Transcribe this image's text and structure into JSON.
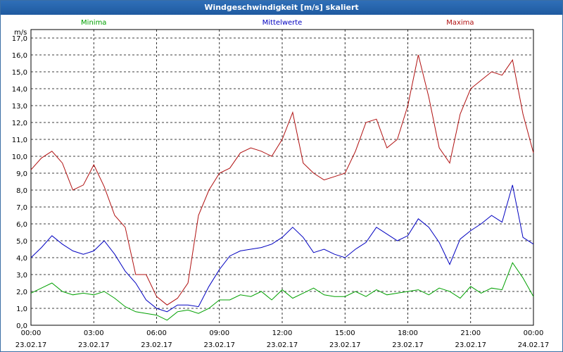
{
  "window": {
    "title": "Windgeschwindigkeit [m/s] skaliert"
  },
  "chart_data": {
    "type": "line",
    "title": "Windgeschwindigkeit [m/s] skaliert",
    "ylabel": "m/s",
    "ylim": [
      0,
      17.5
    ],
    "xlim": [
      0,
      24
    ],
    "grid": true,
    "legend_placement": "top",
    "y_ticks": [
      "0,0",
      "1,0",
      "2,0",
      "3,0",
      "4,0",
      "5,0",
      "6,0",
      "7,0",
      "8,0",
      "9,0",
      "10,0",
      "11,0",
      "12,0",
      "13,0",
      "14,0",
      "15,0",
      "16,0",
      "17,0"
    ],
    "x_ticks": [
      {
        "time": "00:00",
        "date": "23.02.17"
      },
      {
        "time": "03:00",
        "date": "23.02.17"
      },
      {
        "time": "06:00",
        "date": "23.02.17"
      },
      {
        "time": "09:00",
        "date": "23.02.17"
      },
      {
        "time": "12:00",
        "date": "23.02.17"
      },
      {
        "time": "15:00",
        "date": "23.02.17"
      },
      {
        "time": "18:00",
        "date": "23.02.17"
      },
      {
        "time": "21:00",
        "date": "23.02.17"
      },
      {
        "time": "00:00",
        "date": "24.02.17"
      }
    ],
    "series": [
      {
        "name": "Minima",
        "color": "#00a000",
        "x": [
          0,
          0.5,
          1,
          1.5,
          2,
          2.5,
          3,
          3.5,
          4,
          4.5,
          5,
          5.5,
          6,
          6.5,
          7,
          7.5,
          8,
          8.5,
          9,
          9.5,
          10,
          10.5,
          11,
          11.5,
          12,
          12.5,
          13,
          13.5,
          14,
          14.5,
          15,
          15.5,
          16,
          16.5,
          17,
          17.5,
          18,
          18.5,
          19,
          19.5,
          20,
          20.5,
          21,
          21.5,
          22,
          22.5,
          23,
          23.5,
          24
        ],
        "y": [
          1.9,
          2.2,
          2.5,
          2.0,
          1.8,
          1.9,
          1.8,
          2.0,
          1.6,
          1.1,
          0.8,
          0.7,
          0.6,
          0.3,
          0.8,
          0.9,
          0.7,
          1.0,
          1.5,
          1.5,
          1.8,
          1.7,
          2.0,
          1.5,
          2.1,
          1.6,
          1.9,
          2.2,
          1.8,
          1.7,
          1.7,
          2.0,
          1.7,
          2.1,
          1.8,
          1.9,
          2.0,
          2.1,
          1.8,
          2.2,
          2.0,
          1.6,
          2.3,
          1.9,
          2.2,
          2.1,
          3.7,
          2.8,
          1.7
        ]
      },
      {
        "name": "Mittelwerte",
        "color": "#0000c0",
        "x": [
          0,
          0.5,
          1,
          1.5,
          2,
          2.5,
          3,
          3.5,
          4,
          4.5,
          5,
          5.5,
          6,
          6.5,
          7,
          7.5,
          8,
          8.5,
          9,
          9.5,
          10,
          10.5,
          11,
          11.5,
          12,
          12.5,
          13,
          13.5,
          14,
          14.5,
          15,
          15.5,
          16,
          16.5,
          17,
          17.5,
          18,
          18.5,
          19,
          19.5,
          20,
          20.5,
          21,
          21.5,
          22,
          22.5,
          23,
          23.5,
          24
        ],
        "y": [
          4.0,
          4.6,
          5.3,
          4.8,
          4.4,
          4.2,
          4.4,
          5.0,
          4.2,
          3.2,
          2.5,
          1.5,
          1.0,
          0.8,
          1.2,
          1.2,
          1.1,
          2.3,
          3.3,
          4.1,
          4.4,
          4.5,
          4.6,
          4.8,
          5.2,
          5.8,
          5.2,
          4.3,
          4.5,
          4.2,
          4.0,
          4.5,
          4.9,
          5.8,
          5.4,
          5.0,
          5.3,
          6.3,
          5.8,
          4.9,
          3.6,
          5.1,
          5.6,
          6.0,
          6.5,
          6.1,
          8.3,
          5.2,
          4.8
        ]
      },
      {
        "name": "Maxima",
        "color": "#b01010",
        "x": [
          0,
          0.5,
          1,
          1.5,
          2,
          2.5,
          3,
          3.5,
          4,
          4.5,
          5,
          5.5,
          6,
          6.5,
          7,
          7.5,
          8,
          8.5,
          9,
          9.5,
          10,
          10.5,
          11,
          11.5,
          12,
          12.5,
          13,
          13.5,
          14,
          14.5,
          15,
          15.5,
          16,
          16.5,
          17,
          17.5,
          18,
          18.5,
          19,
          19.5,
          20,
          20.5,
          21,
          21.5,
          22,
          22.5,
          23,
          23.5,
          24
        ],
        "y": [
          9.2,
          9.9,
          10.3,
          9.6,
          8.0,
          8.3,
          9.5,
          8.2,
          6.5,
          5.8,
          3.0,
          3.0,
          1.7,
          1.2,
          1.6,
          2.5,
          6.5,
          8.0,
          9.0,
          9.3,
          10.2,
          10.5,
          10.3,
          10.0,
          11.0,
          12.6,
          9.6,
          9.0,
          8.6,
          8.8,
          9.0,
          10.3,
          12.0,
          12.2,
          10.5,
          11.0,
          13.0,
          16.0,
          13.5,
          10.5,
          9.6,
          12.5,
          14.0,
          14.5,
          15.0,
          14.8,
          15.7,
          12.5,
          10.2
        ]
      }
    ]
  }
}
